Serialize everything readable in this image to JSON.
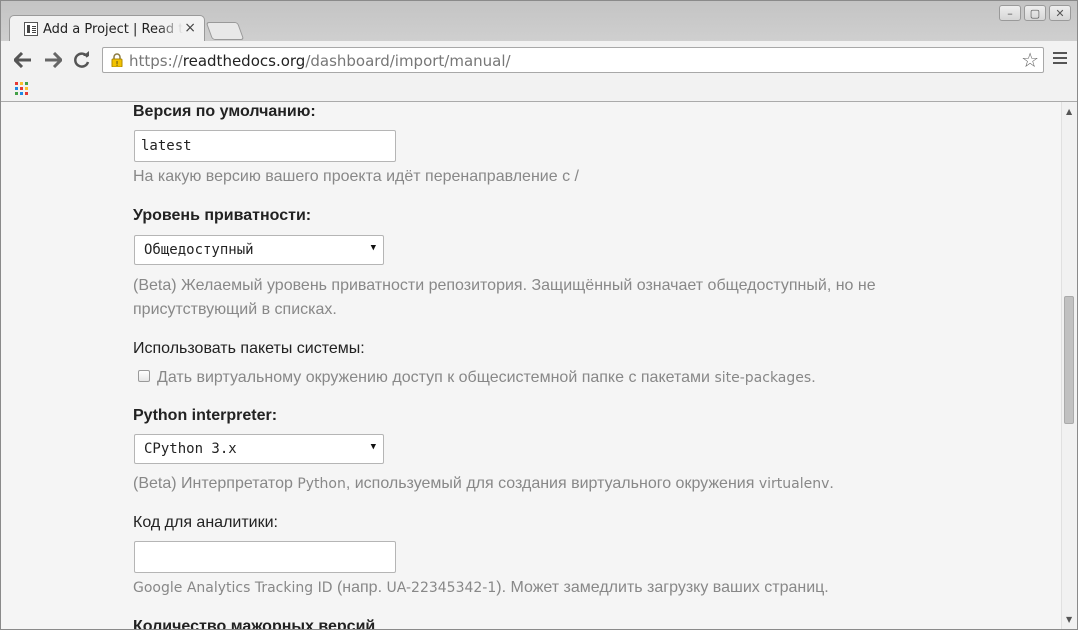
{
  "browser": {
    "tab_title": "Add a Project | Read the Docs",
    "tab_close": "×",
    "url_scheme": "https://",
    "url_host": "readthedocs.org",
    "url_path": "/dashboard/import/manual/",
    "window_buttons": [
      "–",
      "▢",
      "✕"
    ],
    "icons": {
      "back": "back-arrow-icon",
      "forward": "forward-arrow-icon",
      "reload": "reload-icon",
      "star": "bookmark-star-icon",
      "menu": "hamburger-menu-icon",
      "apps": "apps-grid-icon"
    }
  },
  "form": {
    "default_version": {
      "label": "Версия по умолчанию:",
      "value": "latest",
      "help": "На какую версию вашего проекта идёт перенаправление с /"
    },
    "privacy_level": {
      "label": "Уровень приватности:",
      "selected": "Общедоступный",
      "help_line1": "(Beta) Желаемый уровень приватности репозитория. Защищённый означает общедоступный, но не",
      "help_line2": "присутствующий в списках."
    },
    "system_packages": {
      "label": "Использовать пакеты системы:",
      "checked": false,
      "checkbox_text": "Дать виртуальному окружению доступ к общесистемной папке с пакетами ",
      "checkbox_code": "site-packages",
      "checkbox_end": "."
    },
    "python_interpreter": {
      "label": "Python interpreter:",
      "selected": "CPython 3.x",
      "help_prefix": "(Beta) Интерпретатор ",
      "help_code1": "Python",
      "help_middle": ", используемый для создания виртуального окружения ",
      "help_code2": "virtualenv",
      "help_end": "."
    },
    "analytics_code": {
      "label": "Код для аналитики:",
      "value": "",
      "help_code": "Google Analytics Tracking ID",
      "help_middle": " (напр. ",
      "help_code2": "UA-22345342-1",
      "help_end": "). Может замедлить загрузку ваших страниц."
    },
    "next_label_partial": "Количество мажорных версий"
  },
  "colors": {
    "page_bg": "#f5f5f5",
    "label": "#222222",
    "help": "#888888"
  }
}
